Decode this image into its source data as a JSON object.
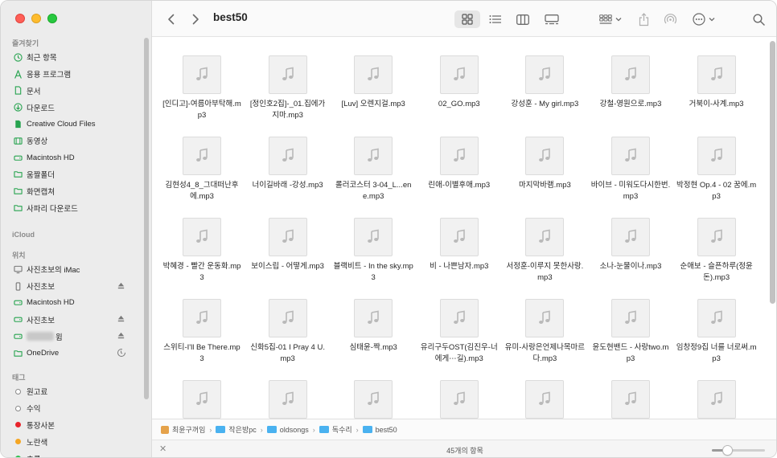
{
  "window": {
    "title": "best50"
  },
  "sidebar": {
    "favorites_header": "즐겨찾기",
    "favorites": [
      {
        "label": "최근 항목",
        "icon": "clock-icon"
      },
      {
        "label": "응용 프로그램",
        "icon": "applications-icon"
      },
      {
        "label": "문서",
        "icon": "document-icon"
      },
      {
        "label": "다운로드",
        "icon": "download-icon"
      },
      {
        "label": "Creative Cloud Files",
        "icon": "file-icon"
      },
      {
        "label": "동영상",
        "icon": "film-icon"
      },
      {
        "label": "Macintosh HD",
        "icon": "disk-icon"
      },
      {
        "label": "움짤폴더",
        "icon": "folder-icon"
      },
      {
        "label": "화면캡쳐",
        "icon": "folder-icon"
      },
      {
        "label": "사파리 다운로드",
        "icon": "folder-icon"
      }
    ],
    "icloud_header": "iCloud",
    "locations_header": "위치",
    "locations": [
      {
        "label": "사진초보의 iMac",
        "icon": "computer-icon",
        "right": ""
      },
      {
        "label": "사진초보",
        "icon": "phone-icon",
        "right": "eject-icon"
      },
      {
        "label": "Macintosh HD",
        "icon": "disk-icon",
        "right": ""
      },
      {
        "label": "사진초보",
        "icon": "disk-icon",
        "right": "eject-icon"
      },
      {
        "label": "윔",
        "icon": "disk-icon",
        "right": "eject-icon"
      },
      {
        "label": "OneDrive",
        "icon": "folder-icon",
        "right": "sync-icon"
      }
    ],
    "tags_header": "태그",
    "tags": [
      {
        "label": "원고료",
        "color": "#ffffff"
      },
      {
        "label": "수익",
        "color": "#ffffff"
      },
      {
        "label": "통장사본",
        "color": "#e8242b"
      },
      {
        "label": "노란색",
        "color": "#f5a623"
      },
      {
        "label": "초록",
        "color": "#2fbf4f"
      }
    ]
  },
  "files": [
    "[인디고]-여름아부탁해.mp3",
    "[정인호2집]-_01.집에가지마.mp3",
    "[Luv] 오렌지걸.mp3",
    "02_GO.mp3",
    "강성훈 - My girl.mp3",
    "강철-영원으로.mp3",
    "거북이-사계.mp3",
    "김현성4_8_그대떠난후에.mp3",
    "너이길바래 -강성.mp3",
    "롤러코스터 3-04_L...ene.mp3",
    "린애-이별후애.mp3",
    "마지막바램.mp3",
    "바이브 - 미워도다시한번.mp3",
    "박정현 Op.4 - 02 꿈에.mp3",
    "박혜경 - 빨간 운동화.mp3",
    "보이스립 - 어떻게.mp3",
    "블랙비트 - In the sky.mp3",
    "비 - 나쁜남자.mp3",
    "서정훈-이루지 못한사랑.mp3",
    "소나-눈물이나.mp3",
    "순애보 - 슬픈하루(정윤돈).mp3",
    "스위티-I'll Be There.mp3",
    "신화5집-01 I Pray 4 U.mp3",
    "심태윤-짝.mp3",
    "유리구두OST(김진우-너에게⋯길).mp3",
    "유미-사랑은언제나목마르다.mp3",
    "윤도현밴드 - 사랑two.mp3",
    "임창정9집 너를 너로써.mp3",
    "",
    "",
    "",
    "",
    "",
    "",
    ""
  ],
  "pathbar": [
    {
      "label": "최윤구꺼임",
      "kind": "home"
    },
    {
      "label": "작은방pc",
      "kind": "folder"
    },
    {
      "label": "oldsongs",
      "kind": "folder"
    },
    {
      "label": "독수리",
      "kind": "folder"
    },
    {
      "label": "best50",
      "kind": "folder"
    }
  ],
  "status": {
    "item_count": "45개의 항목",
    "zoom_level": 0.3
  },
  "colors": {
    "sidebar_icon": "#27a34f",
    "folder_blue": "#4ab2f0"
  }
}
